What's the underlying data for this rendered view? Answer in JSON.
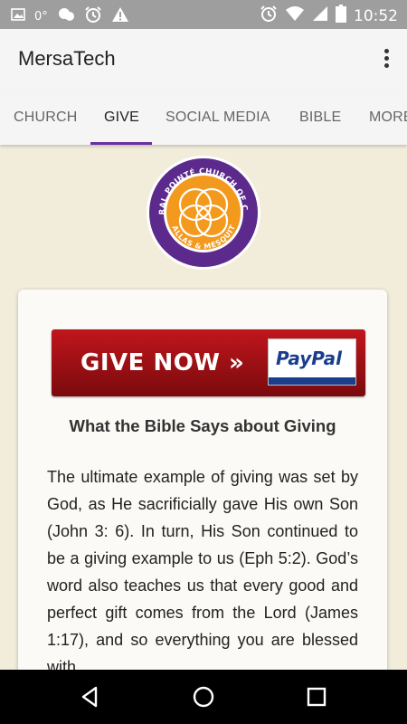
{
  "status_bar": {
    "notification_text": "0°",
    "time": "10:52",
    "left_icons": [
      "image-icon",
      "weather-icon",
      "gear-notification-icon",
      "alarm-icon",
      "warning-icon"
    ],
    "right_icons": [
      "alarm-icon",
      "wifi-icon",
      "signal-icon",
      "battery-icon"
    ]
  },
  "app_bar": {
    "title": "MersaTech",
    "overflow_icon": "more-vert-icon"
  },
  "tabs": [
    {
      "label": "CHURCH",
      "active": false
    },
    {
      "label": "GIVE",
      "active": true
    },
    {
      "label": "SOCIAL MEDIA",
      "active": false
    },
    {
      "label": "BIBLE",
      "active": false
    },
    {
      "label": "MORE",
      "active": false
    }
  ],
  "logo": {
    "top_text": "CENTRAL POINTÉ CHURCH OF CHRIST",
    "bottom_text": "DALLAS & MESQUITE"
  },
  "card": {
    "give_button": {
      "label": "GIVE NOW »",
      "brand": "PayPal"
    },
    "heading": "What the Bible Says about Giving",
    "body": "The ultimate example of giving was set by God, as He sacrificially gave His own Son (John 3: 6). In turn, His Son continued to be a giving example to us (Eph 5:2). God’s word also teaches us that every good and perfect gift comes from the Lord (James 1:17), and so everything you are blessed with"
  },
  "nav_bar": {
    "buttons": [
      "back-icon",
      "home-icon",
      "recents-icon"
    ]
  },
  "colors": {
    "accent": "#6a2fa0",
    "background": "#f2ecdb",
    "status_bar": "#9e9e9e",
    "give_button": "#a81218",
    "paypal_blue": "#1a3e8c",
    "logo_orange": "#f39a1e",
    "logo_purple": "#5b2a8c"
  }
}
